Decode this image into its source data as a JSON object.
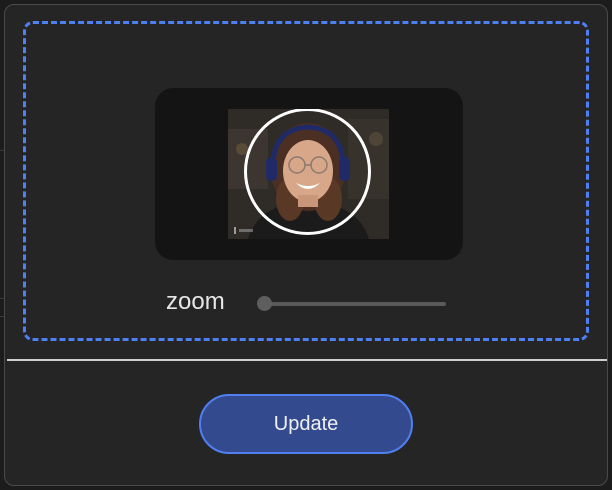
{
  "colors": {
    "accent": "#4f7ff0",
    "button_fill": "#344a8e",
    "panel": "#252525"
  },
  "cropper": {
    "photo_icon": "person-photo",
    "zoom_label": "zoom",
    "zoom_level": 0
  },
  "footer": {
    "update_label": "Update"
  }
}
